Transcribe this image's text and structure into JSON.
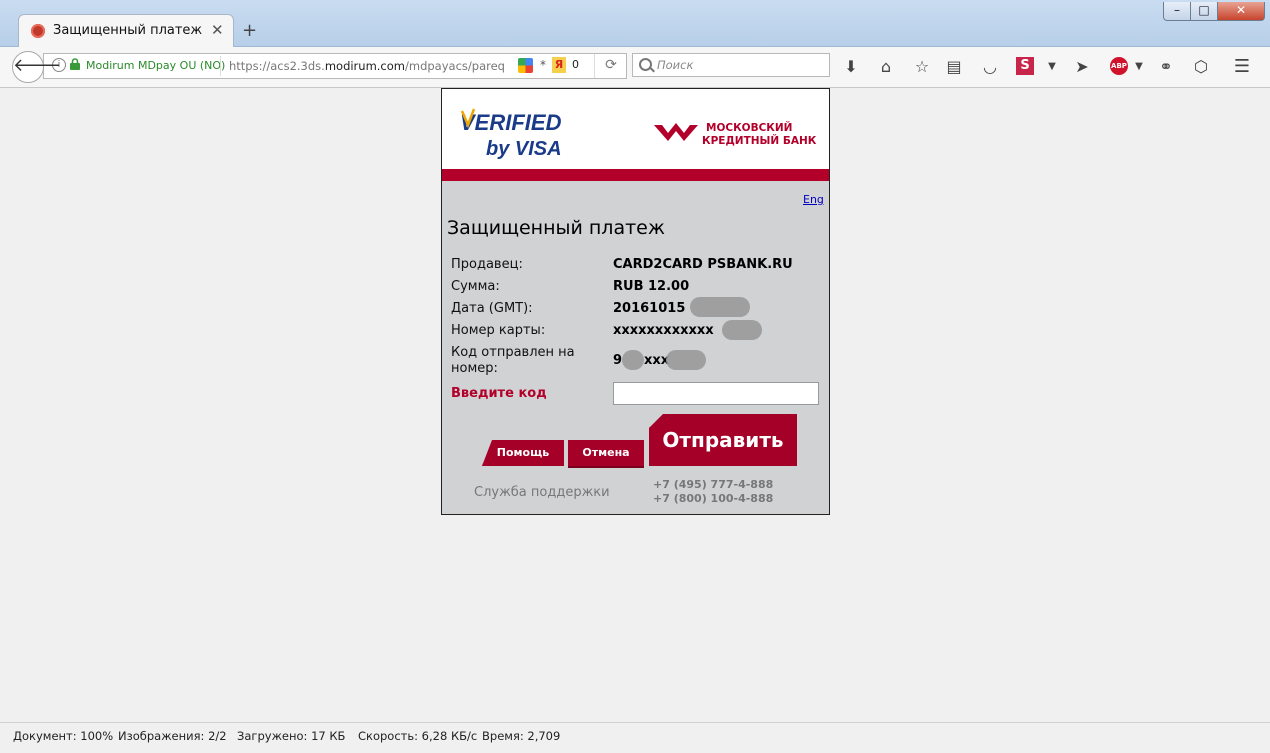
{
  "browser": {
    "tab_title": "Защищенный платеж",
    "tab_close": "✕",
    "new_tab": "+",
    "window_min": "–",
    "window_max": "□",
    "window_close": "✕",
    "site_identity": "Modirum MDpay OU (NO)",
    "url_prefix": "https://acs2.3ds.",
    "url_domain": "modirum.com",
    "url_path": "/mdpayacs/pareq",
    "yandex_count": "0",
    "search_placeholder": "Поиск",
    "icons": [
      "back-arrow-icon",
      "info-icon",
      "lock-icon",
      "google-icon",
      "yandex-icon",
      "reload-icon",
      "search-icon",
      "download-icon",
      "home-icon",
      "bookmark-star-icon",
      "reading-list-icon",
      "pocket-icon",
      "s-extension-icon",
      "dropdown-arrow-icon",
      "send-icon",
      "adblock-icon",
      "extension-icon",
      "shield-icon",
      "menu-icon"
    ]
  },
  "payment": {
    "brand_logo_text": "VERIFIED by VISA",
    "bank_name_line1": "МОСКОВСКИЙ",
    "bank_name_line2": "КРЕДИТНЫЙ БАНК",
    "lang_link": "Eng",
    "title": "Защищенный платеж",
    "fields": [
      {
        "label": "Продавец:",
        "value": "CARD2CARD PSBANK.RU"
      },
      {
        "label": "Сумма:",
        "value": "RUB 12.00"
      },
      {
        "label": "Дата (GMT):",
        "value": "20161015"
      },
      {
        "label": "Номер карты:",
        "value": "xxxxxxxxxxxx"
      },
      {
        "label": "Код отправлен на номер:",
        "value": "9"
      }
    ],
    "phone_mask": "xxx",
    "code_label": "Введите код",
    "code_value": "",
    "help_button": "Помощь",
    "cancel_button": "Отмена",
    "submit_button": "Отправить",
    "support_label": "Служба поддержки",
    "phone1": "+7 (495) 777-4-888",
    "phone2": "+7 (800) 100-4-888",
    "colors": {
      "accent": "#b2002a",
      "panel": "#d1d2d4"
    }
  },
  "status": {
    "document": "Документ: 100%",
    "images": "Изображения: 2/2",
    "loaded": "Загружено: 17 КБ",
    "speed": "Скорость: 6,28 КБ/с",
    "time": "Время: 2,709"
  }
}
